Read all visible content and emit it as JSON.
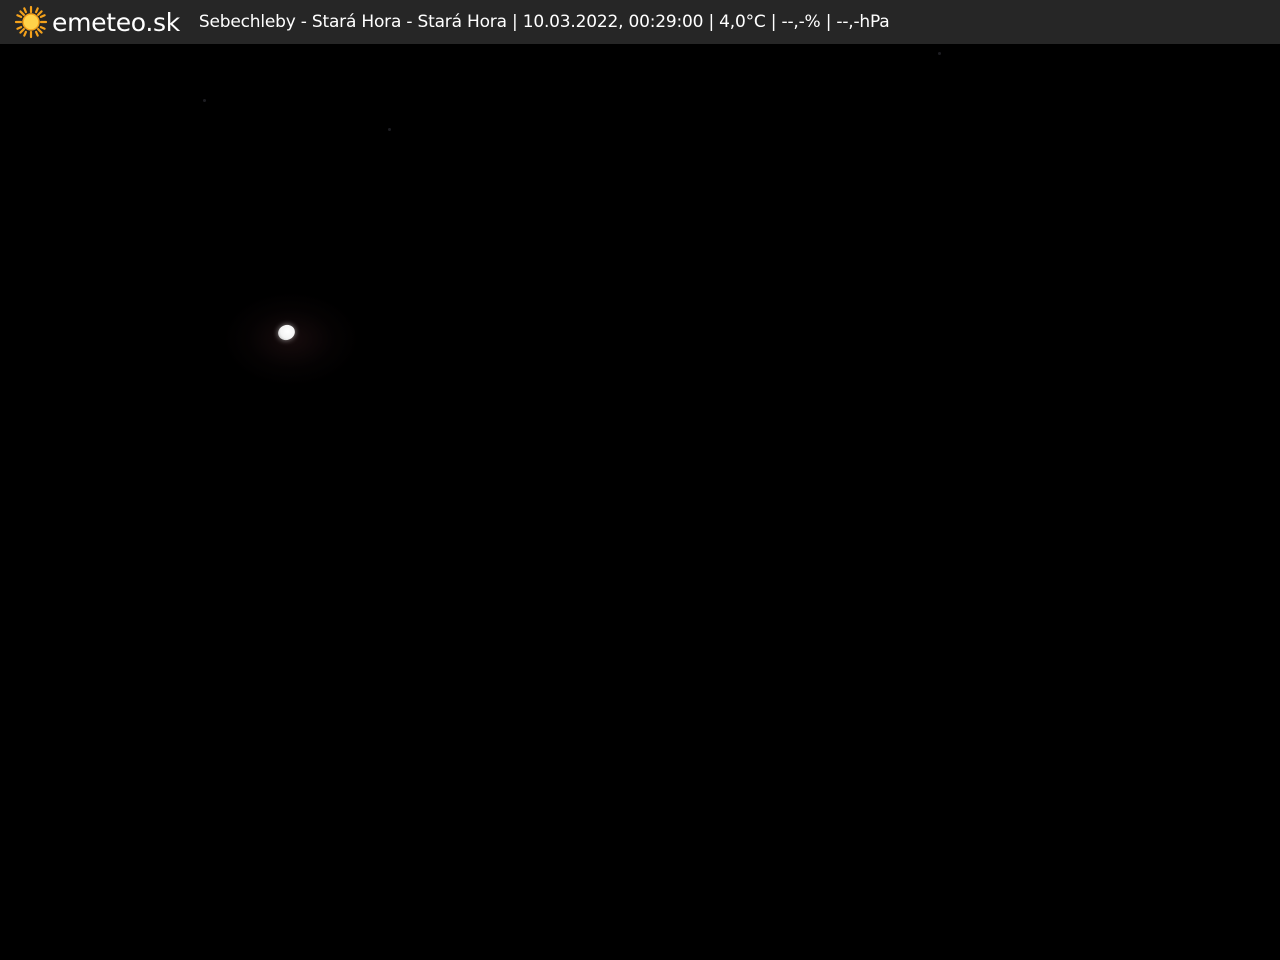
{
  "brand": {
    "icon": "sun-icon",
    "name": "emeteo.sk",
    "accent_color": "#f5a21b"
  },
  "caption": {
    "location": "Sebechleby - Stará Hora - Stará Hora",
    "datetime": "10.03.2022, 00:29:00",
    "temperature": "4,0°C",
    "humidity": "--,-%",
    "pressure": "--,-hPa",
    "separator": " | "
  },
  "camera": {
    "scene": "night-sky",
    "objects": [
      "moon"
    ]
  },
  "colors": {
    "topbar_bg": "#262626",
    "scene_bg": "#000000",
    "text": "#ffffff"
  }
}
